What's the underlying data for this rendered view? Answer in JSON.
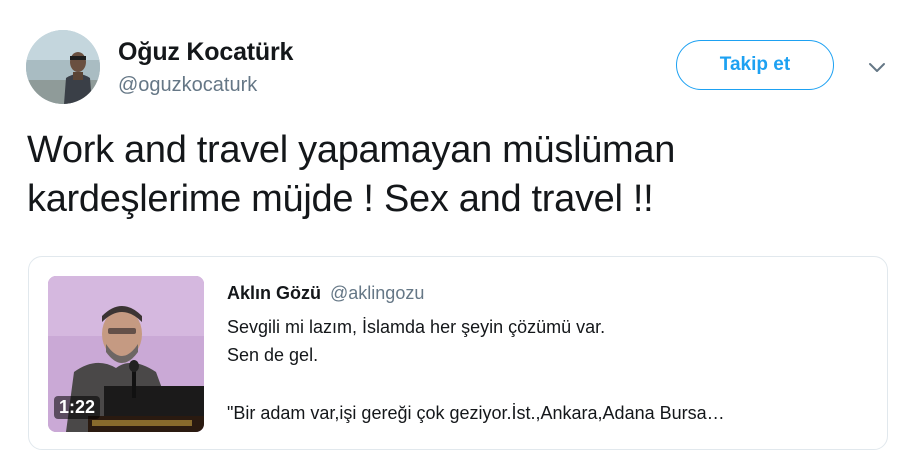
{
  "author": {
    "display_name": "Oğuz Kocatürk",
    "handle": "@oguzkocaturk"
  },
  "actions": {
    "follow_label": "Takip et",
    "menu_icon": "chevron-down-icon"
  },
  "tweet": {
    "lines": [
      "Work and travel yapamayan müslüman",
      "kardeşlerime müjde ! Sex and travel !!"
    ]
  },
  "quoted_tweet": {
    "display_name": "Aklın Gözü",
    "handle": "@aklingozu",
    "lines": [
      "Sevgili mi lazım, İslamda her şeyin çözümü var.",
      "Sen de gel.",
      "\"Bir adam var,işi gereği çok geziyor.İst.,Ankara,Adana Bursa…"
    ],
    "video_duration": "1:22"
  },
  "colors": {
    "accent": "#1da1f2",
    "text": "#14171a",
    "secondary_text": "#657786",
    "border": "#e1e8ed"
  }
}
